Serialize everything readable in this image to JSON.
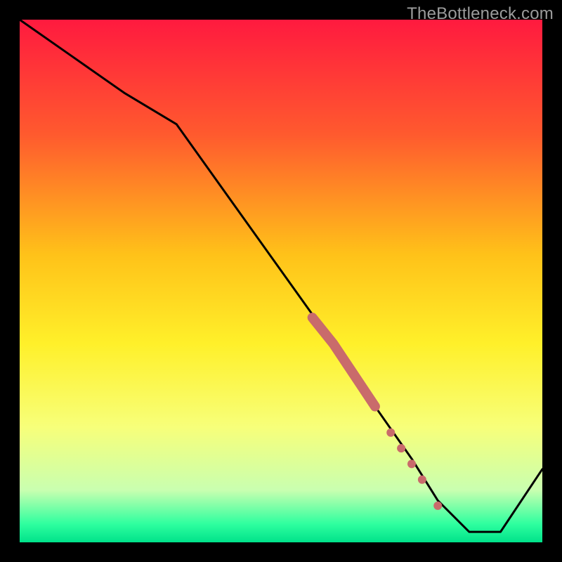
{
  "watermark": "TheBottleneck.com",
  "chart_data": {
    "type": "line",
    "title": "",
    "xlabel": "",
    "ylabel": "",
    "xlim": [
      0,
      100
    ],
    "ylim": [
      0,
      100
    ],
    "background": {
      "type": "vertical_gradient",
      "description": "red (top) → orange → yellow → pale green → green (bottom)",
      "stops": [
        {
          "pos": 0.0,
          "color": "#ff1a3f"
        },
        {
          "pos": 0.22,
          "color": "#ff5a2e"
        },
        {
          "pos": 0.45,
          "color": "#ffc219"
        },
        {
          "pos": 0.62,
          "color": "#fff02a"
        },
        {
          "pos": 0.78,
          "color": "#f7ff7a"
        },
        {
          "pos": 0.9,
          "color": "#c9ffb0"
        },
        {
          "pos": 0.965,
          "color": "#2eff9f"
        },
        {
          "pos": 1.0,
          "color": "#00e28a"
        }
      ]
    },
    "series": [
      {
        "name": "bottleneck-curve",
        "color": "#000000",
        "x": [
          0,
          10,
          20,
          30,
          40,
          50,
          60,
          68,
          75,
          80,
          86,
          92,
          100
        ],
        "y": [
          100,
          93,
          86,
          80,
          66,
          52,
          38,
          26,
          16,
          8,
          2,
          2,
          14
        ]
      }
    ],
    "highlighted_segments": [
      {
        "name": "highlight-band",
        "color": "#c96b6b",
        "description": "thick salmon segment overlay on the descending line near the bottom",
        "x": [
          56,
          60,
          64,
          68
        ],
        "y": [
          43,
          38,
          32,
          26
        ]
      },
      {
        "name": "highlight-dots",
        "color": "#c96b6b",
        "points": [
          {
            "x": 71,
            "y": 21
          },
          {
            "x": 73,
            "y": 18
          },
          {
            "x": 75,
            "y": 15
          },
          {
            "x": 77,
            "y": 12
          },
          {
            "x": 80,
            "y": 7
          }
        ]
      }
    ]
  }
}
